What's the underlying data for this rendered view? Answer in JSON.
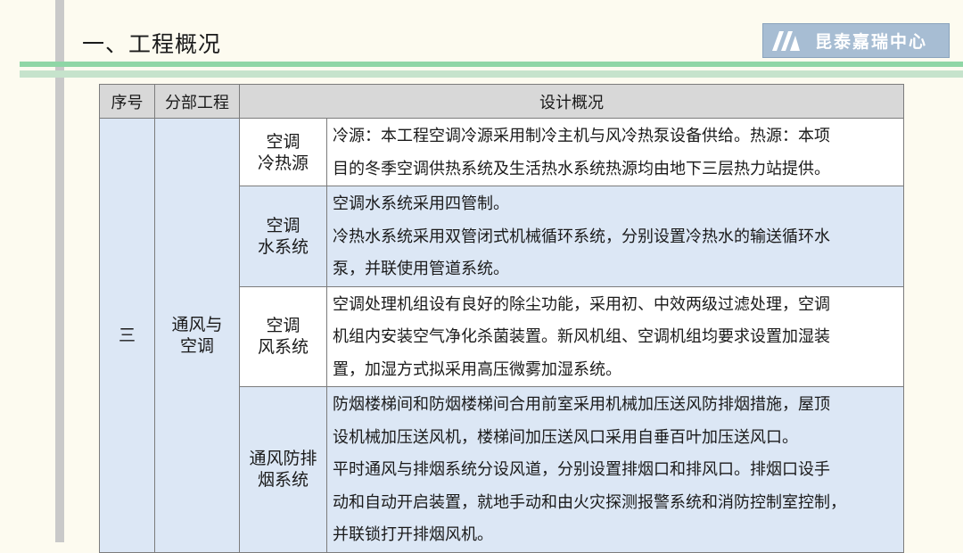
{
  "header": {
    "title": "一、工程概况",
    "logo_text": "昆泰嘉瑞中心"
  },
  "table": {
    "headers": [
      "序号",
      "分部工程",
      "设计概况"
    ],
    "index": "三",
    "division": [
      "通风与",
      "空调"
    ],
    "rows": [
      {
        "item": [
          "空调",
          "冷热源"
        ],
        "lines": [
          "冷源：本工程空调冷源采用制冷主机与风冷热泵设备供给。热源：本项",
          "目的冬季空调供热系统及生活热水系统热源均由地下三层热力站提供。"
        ]
      },
      {
        "item": [
          "空调",
          "水系统"
        ],
        "lines": [
          "空调水系统采用四管制。",
          "冷热水系统采用双管闭式机械循环系统，分别设置冷热水的输送循环水",
          "泵，并联使用管道系统。"
        ]
      },
      {
        "item": [
          "空调",
          "风系统"
        ],
        "lines": [
          "空调处理机组设有良好的除尘功能，采用初、中效两级过滤处理，空调",
          "机组内安装空气净化杀菌装置。新风机组、空调机组均要求设置加湿装",
          "置，加湿方式拟采用高压微雾加湿系统。"
        ]
      },
      {
        "item": [
          "通风防排",
          "烟系统"
        ],
        "lines": [
          "防烟楼梯间和防烟楼梯间合用前室采用机械加压送风防排烟措施，屋顶",
          "设机械加压送风机，楼梯间加压送风口采用自垂百叶加压送风口。",
          "平时通风与排烟系统分设风道，分别设置排烟口和排风口。排烟口设手",
          "动和自动开启装置，就地手动和由火灾探测报警系统和消防控制室控制，",
          "并联锁打开排烟风机。"
        ]
      }
    ]
  }
}
